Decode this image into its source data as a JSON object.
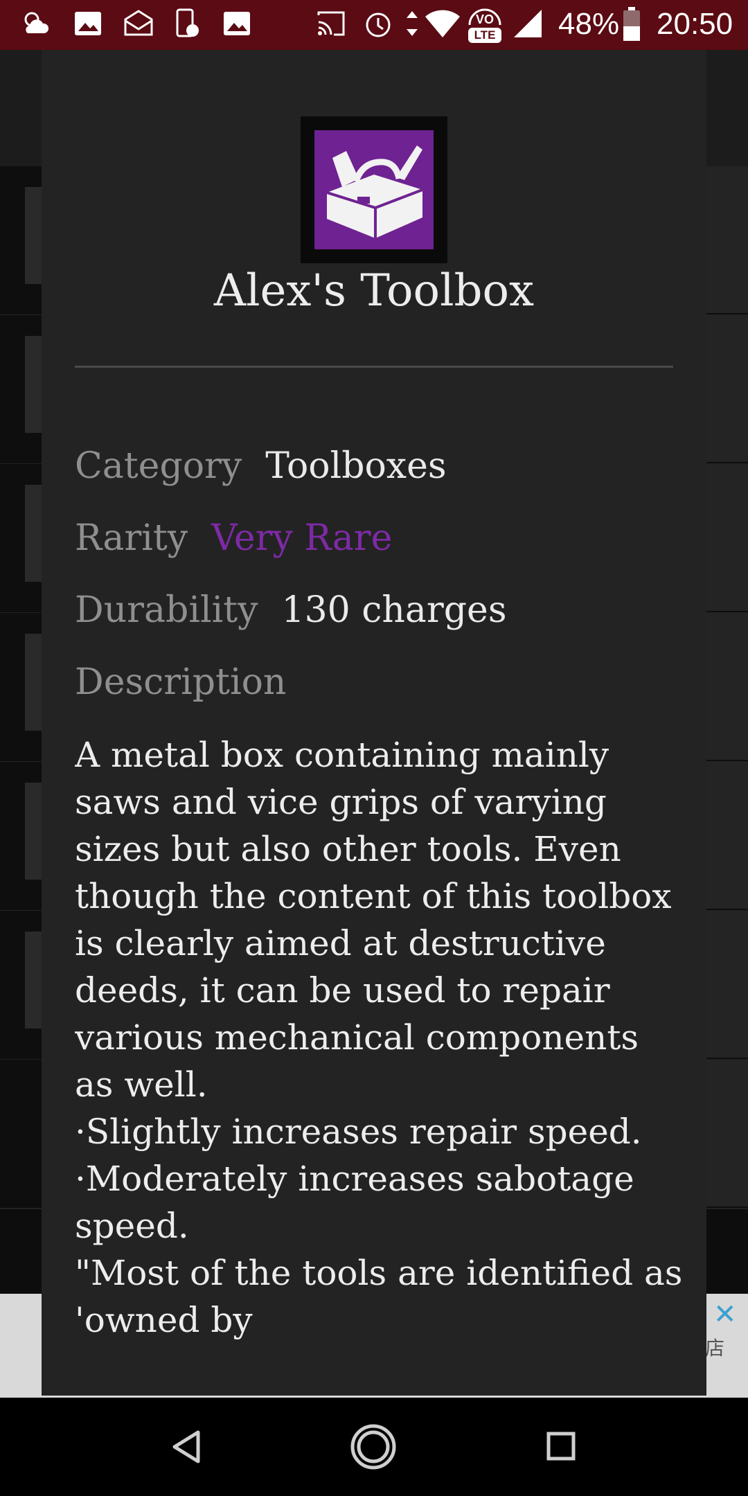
{
  "status_bar": {
    "battery_percent": "48%",
    "time": "20:50",
    "lte_label": "LTE",
    "icons": [
      "weather-cloudy-icon",
      "image-icon",
      "email-icon",
      "phone-alert-icon",
      "image-icon",
      "cast-icon",
      "alarm-icon",
      "data-arrows-icon",
      "wifi-icon",
      "volte-icon",
      "signal-icon",
      "battery-icon"
    ]
  },
  "dialog": {
    "title": "Alex's Toolbox",
    "image_icon": "toolbox-icon",
    "accent_color": "#6f2291",
    "fields": [
      {
        "label": "Category",
        "value": "Toolboxes"
      },
      {
        "label": "Rarity",
        "value": "Very Rare",
        "value_color": "#7e2aa6"
      },
      {
        "label": "Durability",
        "value": "130 charges"
      }
    ],
    "description_label": "Description",
    "description_lines": [
      "A metal box containing mainly saws and vice grips of varying sizes but also other tools. Even though the content of this toolbox is clearly aimed at destructive deeds, it can be used to repair various mechanical components as well.",
      "·Slightly increases repair speed.",
      "·Moderately increases sabotage speed.",
      "\"Most of the tools are identified as 'owned by"
    ]
  },
  "ad_banner": {
    "close_glyph": "✕",
    "text": "店"
  },
  "nav_bar": {
    "icons": [
      "back-icon",
      "home-icon",
      "recents-icon"
    ]
  }
}
